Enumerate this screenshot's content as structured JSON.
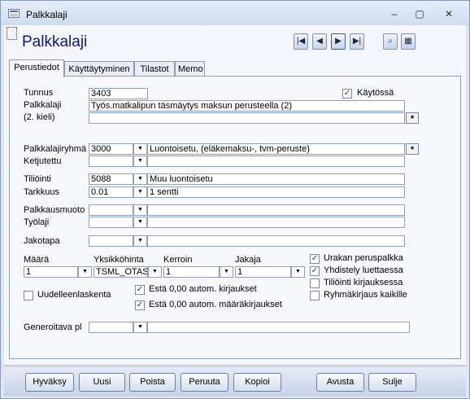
{
  "window": {
    "title": "Palkkalaji"
  },
  "form": {
    "heading": "Palkkalaji"
  },
  "nav": {
    "first": "|◀",
    "prev": "◀",
    "next": "▶",
    "last": "▶|",
    "find": "⌕",
    "grid": "▦"
  },
  "tabs": [
    {
      "label": "Perustiedot"
    },
    {
      "label": "Käyttäytyminen"
    },
    {
      "label": "Tilastot"
    },
    {
      "label": "Memo"
    }
  ],
  "fields": {
    "tunnus_label": "Tunnus",
    "tunnus_value": "3403",
    "kaytossa_label": "Käytössä",
    "kaytossa_checked": true,
    "palkkalaji_label": "Palkkalaji",
    "palkkalaji_value": "Työs.matkalipun täsmäytys maksun perusteella (2)",
    "toinen_kieli_label": "(2. kieli)",
    "toinen_kieli_value": "",
    "palkkalajiryhma_label": "Palkkalajiryhmä",
    "palkkalajiryhma_code": "3000",
    "palkkalajiryhma_desc": "Luontoisetu, (eläkemaksu-, tvm-peruste)",
    "ketjutettu_label": "Ketjutettu",
    "ketjutettu_value": "",
    "tiliointi_label": "Tiliöinti",
    "tiliointi_code": "5088",
    "tiliointi_desc": "Muu luontoisetu",
    "tarkkuus_label": "Tarkkuus",
    "tarkkuus_code": "0.01",
    "tarkkuus_desc": "1 sentti",
    "palkkausmuoto_label": "Palkkausmuoto",
    "palkkausmuoto_code": "",
    "palkkausmuoto_desc": "",
    "tyolaji_label": "Työlaji",
    "tyolaji_code": "",
    "tyolaji_desc": "",
    "jakotapa_label": "Jakotapa",
    "jakotapa_code": "",
    "jakotapa_desc": "",
    "maara_label": "Määrä",
    "maara_value": "1",
    "yksikkohinta_label": "Yksikköhinta",
    "yksikkohinta_value": "TSML_OTAS",
    "kerroin_label": "Kerroin",
    "kerroin_value": "1",
    "jakaja_label": "Jakaja",
    "jakaja_value": "1",
    "uudelleenlaskenta_label": "Uudelleenlaskenta",
    "esta_kirjaukset_label": "Estä 0,00 autom. kirjaukset",
    "esta_maarakirjaukset_label": "Estä 0,00 autom. määräkirjaukset",
    "urakan_label": "Urakan peruspalkka",
    "yhdistely_label": "Yhdistely luettaessa",
    "tiliointi_kirjauksessa_label": "Tiliöinti kirjauksessa",
    "ryhmakirjaus_label": "Ryhmäkirjaus kaikille",
    "generoitava_label": "Generoitava pl",
    "generoitava_code": "",
    "generoitava_desc": ""
  },
  "checks": {
    "urakan": true,
    "yhdistely": true,
    "tiliointi_kirjauksessa": false,
    "ryhmakirjaus": false,
    "uudelleenlaskenta": false,
    "esta_kirjaukset": true,
    "esta_maarakirjaukset": true
  },
  "buttons": {
    "hyvaksy": "Hyväksy",
    "uusi": "Uusi",
    "poista": "Poista",
    "peruuta": "Peruuta",
    "kopioi": "Kopioi",
    "avusta": "Avusta",
    "sulje": "Sulje"
  },
  "symbols": {
    "dropdown": "▼",
    "star": "*",
    "check": "✓"
  }
}
